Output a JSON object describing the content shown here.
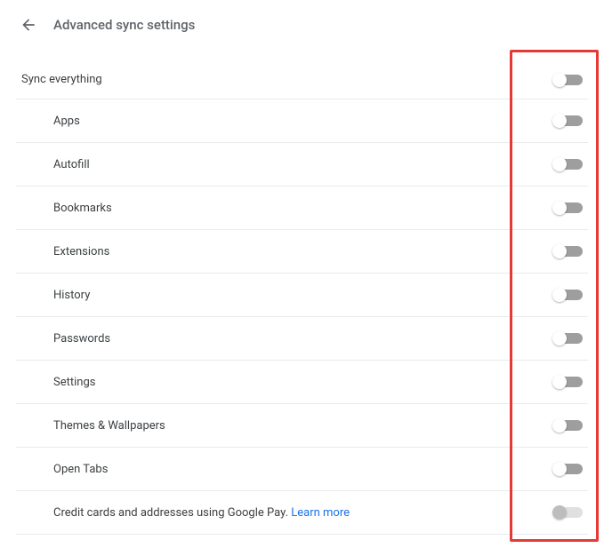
{
  "header": {
    "title": "Advanced sync settings"
  },
  "sync_everything_label": "Sync everything",
  "items": [
    {
      "label": "Apps"
    },
    {
      "label": "Autofill"
    },
    {
      "label": "Bookmarks"
    },
    {
      "label": "Extensions"
    },
    {
      "label": "History"
    },
    {
      "label": "Passwords"
    },
    {
      "label": "Settings"
    },
    {
      "label": "Themes & Wallpapers"
    },
    {
      "label": "Open Tabs"
    }
  ],
  "last_item": {
    "label_prefix": "Credit cards and addresses using Google Pay. ",
    "learn_more": "Learn more"
  }
}
